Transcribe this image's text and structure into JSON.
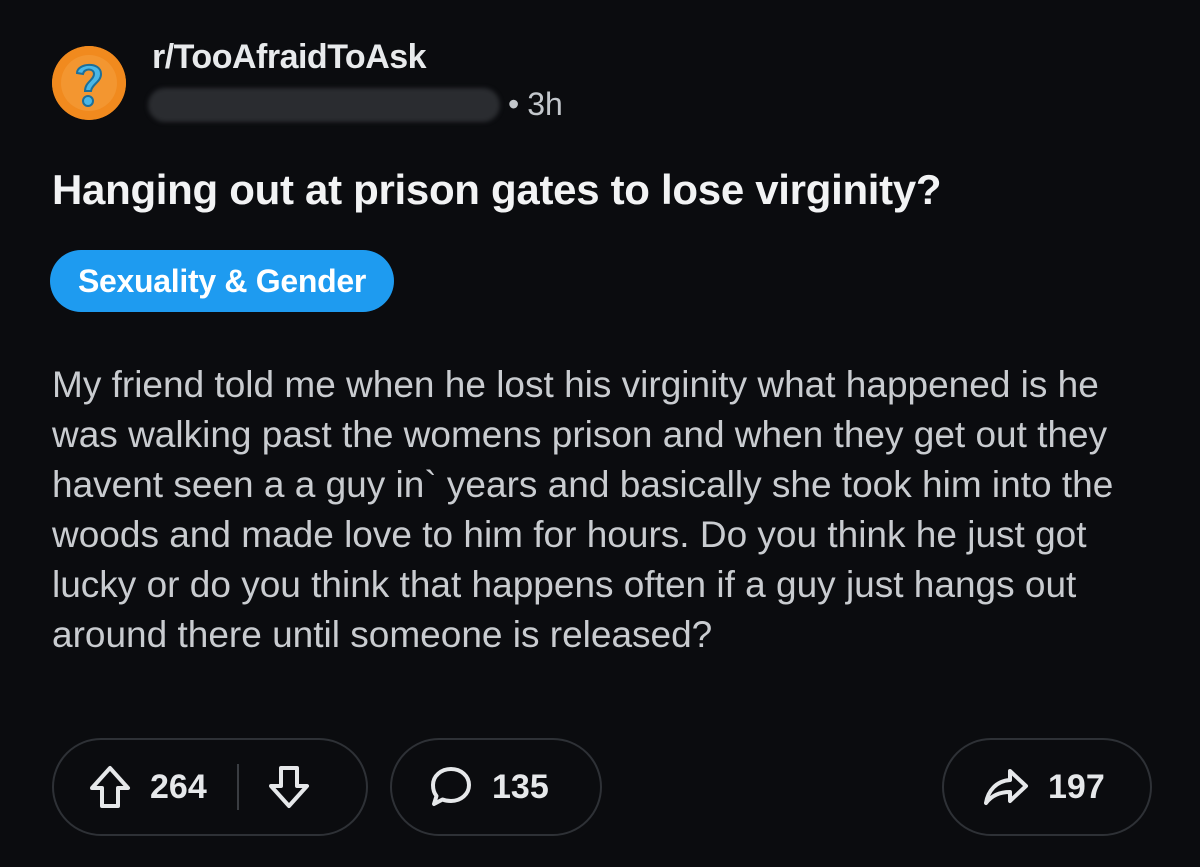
{
  "post": {
    "subreddit": "r/TooAfraidToAsk",
    "time": "3h",
    "meta_separator": "•",
    "title": "Hanging out at prison gates to lose virginity?",
    "flair": "Sexuality & Gender",
    "body": "My friend told me when he lost his virginity what happened is he was walking past the womens prison and when they get out they havent seen a a guy in` years and basically she took him into the woods and made love to him for hours. Do you think he just got lucky or do you think that happens often if a guy just hangs out around there until someone is released?"
  },
  "actions": {
    "upvotes": "264",
    "comments": "135",
    "shares": "197"
  },
  "icons": {
    "avatar": "question-mark-icon",
    "upvote": "arrow-up-icon",
    "downvote": "arrow-down-icon",
    "comment": "comment-bubble-icon",
    "share": "share-arrow-icon"
  },
  "colors": {
    "background": "#0b0c0f",
    "flair": "#1e9bf0",
    "avatar": "#f18a1e"
  }
}
